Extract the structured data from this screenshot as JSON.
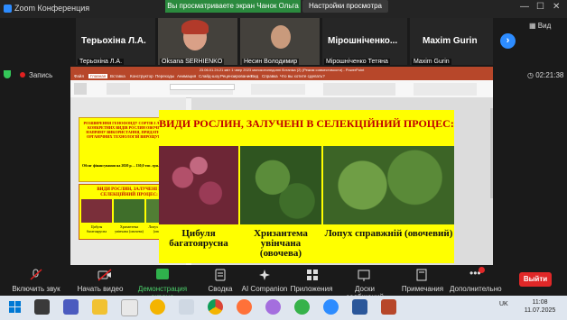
{
  "window": {
    "title": "Zoom Конференция",
    "share_banner": "Вы просматриваете экран Чанок Ольга",
    "view_settings": "Настройки просмотра",
    "view_btn": "Вид"
  },
  "participants": [
    {
      "name": "Терьохіна Л.А.",
      "label": "Терьохіна Л.А."
    },
    {
      "name": "",
      "label": "Oksana SERHIENKO"
    },
    {
      "name": "",
      "label": "Несин Володимир"
    },
    {
      "name": "Мірошніченко...",
      "label": "Мірошніченко Тетяна"
    },
    {
      "name": "Maxim Gurin",
      "label": "Maxim Gurin"
    }
  ],
  "recording": {
    "label": "Запись",
    "timer": "02:21:38"
  },
  "ppt": {
    "title": "23.06.01.24.21 квіт 1 чвер 2023 монокотиледонні ботанікa (2) (Режим совместимости) - PowerPoint",
    "tabs": [
      "Файл",
      "Главная",
      "Вставка",
      "Конструктор",
      "Переходы",
      "Анимация",
      "Слайд-шоу",
      "Рецензирование",
      "Вид",
      "Справка",
      "Что вы хотите сделать?"
    ],
    "thumb1": "РОЗШИРЕННЯ ГЕНОФОНДУ СОРТІВ І ЛІНІЙ НА КОНКРЕТНИХ ВИДІВ РОСЛИН ОВОЧЕВОГО НАПРЯМУ ВИКОРИСТАННЯ, ПРИДАТНИХ ДО ОРГАНІЧНИХ ТЕХНОЛОГІЙ ВИРОЩУВАННЯ",
    "thumb1_fund": "Обсяг фінансування на 2020 р. – 130,0 тис. грн.",
    "thumb2_title": "ВИДИ РОСЛИН, ЗАЛУЧЕНІ В СЕЛЕКЦІЙНИЙ ПРОЦЕС:",
    "thumb2_captions": [
      "Цибуля багатоярусна",
      "Хризантема увінчана (овочева)",
      "Лопух справжній (овочевий)"
    ]
  },
  "slide": {
    "title": "ВИДИ РОСЛИН, ЗАЛУЧЕНІ В СЕЛЕКЦІЙНИЙ ПРОЦЕС:",
    "captions": [
      "Цибуля багатоярусна",
      "Хризантема увінчана (овочева)",
      "Лопух справжній (овочевий)"
    ]
  },
  "controls": {
    "mute": "Включить звук",
    "video": "Начать видео",
    "share": "Демонстрация экрана",
    "reactions": "Сводка",
    "ai": "AI Companion",
    "apps": "Приложения",
    "whiteboards": "Доски сообщений",
    "notes": "Примечания",
    "more": "Дополнительно",
    "leave": "Выйти"
  },
  "taskbar": {
    "lang": "UK",
    "time": "11:08",
    "date": "11.07.2025"
  },
  "colors": {
    "accent": "#2d8cff",
    "ppt": "#b7472a",
    "slide_bg": "#ffff00",
    "slide_title": "#c00000",
    "leave": "#e02828"
  }
}
